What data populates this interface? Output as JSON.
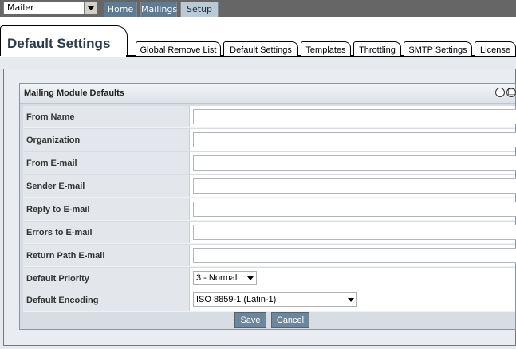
{
  "topbar": {
    "module_select": "Mailer",
    "nav": [
      {
        "label": "Home"
      },
      {
        "label": "Mailings"
      },
      {
        "label": "Setup"
      }
    ]
  },
  "page": {
    "title": "Default Settings"
  },
  "subtabs": [
    {
      "label": "Global Remove List"
    },
    {
      "label": "Default Settings"
    },
    {
      "label": "Templates"
    },
    {
      "label": "Throttling"
    },
    {
      "label": "SMTP Settings"
    },
    {
      "label": "License"
    }
  ],
  "panel": {
    "title": "Mailing Module Defaults",
    "fields": [
      {
        "label": "From Name",
        "value": ""
      },
      {
        "label": "Organization",
        "value": ""
      },
      {
        "label": "From E-mail",
        "value": ""
      },
      {
        "label": "Sender E-mail",
        "value": ""
      },
      {
        "label": "Reply to E-mail",
        "value": ""
      },
      {
        "label": "Errors to E-mail",
        "value": ""
      },
      {
        "label": "Return Path E-mail",
        "value": ""
      }
    ],
    "priority": {
      "label": "Default Priority",
      "value": "3 - Normal"
    },
    "encoding": {
      "label": "Default Encoding",
      "value": "ISO 8859-1 (Latin-1)"
    },
    "save_label": "Save",
    "cancel_label": "Cancel"
  }
}
